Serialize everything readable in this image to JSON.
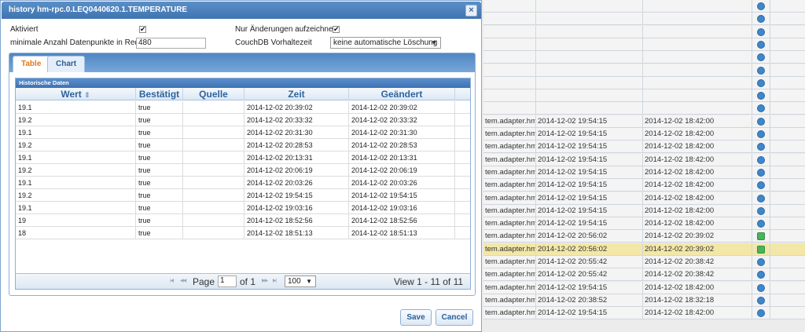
{
  "dialog": {
    "title": "history hm-rpc.0.LEQ0440620.1.TEMPERATURE",
    "close_icon": "×",
    "aktiviert_label": "Aktiviert",
    "aktiviert_checked": true,
    "nur_aenderungen_label": "Nur Änderungen aufzeichnen",
    "nur_aenderungen_checked": true,
    "min_datenpunkte_label": "minimale Anzahl Datenpunkte in Redis",
    "min_datenpunkte_value": "480",
    "couchdb_label": "CouchDB Vorhaltezeit",
    "couchdb_value": "keine automatische Löschung",
    "check_mark": "✔",
    "dropdown_arrow": "▼",
    "tabs": [
      {
        "label": "Table",
        "active": true
      },
      {
        "label": "Chart",
        "active": false
      }
    ],
    "grid": {
      "caption": "Historische Daten",
      "columns": [
        "Wert",
        "Bestätigt",
        "Quelle",
        "Zeit",
        "Geändert"
      ],
      "sort_icon": "⇕",
      "rows": [
        [
          "19.1",
          "true",
          "",
          "2014-12-02 20:39:02",
          "2014-12-02 20:39:02"
        ],
        [
          "19.2",
          "true",
          "",
          "2014-12-02 20:33:32",
          "2014-12-02 20:33:32"
        ],
        [
          "19.1",
          "true",
          "",
          "2014-12-02 20:31:30",
          "2014-12-02 20:31:30"
        ],
        [
          "19.2",
          "true",
          "",
          "2014-12-02 20:28:53",
          "2014-12-02 20:28:53"
        ],
        [
          "19.1",
          "true",
          "",
          "2014-12-02 20:13:31",
          "2014-12-02 20:13:31"
        ],
        [
          "19.2",
          "true",
          "",
          "2014-12-02 20:06:19",
          "2014-12-02 20:06:19"
        ],
        [
          "19.1",
          "true",
          "",
          "2014-12-02 20:03:26",
          "2014-12-02 20:03:26"
        ],
        [
          "19.2",
          "true",
          "",
          "2014-12-02 19:54:15",
          "2014-12-02 19:54:15"
        ],
        [
          "19.1",
          "true",
          "",
          "2014-12-02 19:03:16",
          "2014-12-02 19:03:16"
        ],
        [
          "19",
          "true",
          "",
          "2014-12-02 18:52:56",
          "2014-12-02 18:52:56"
        ],
        [
          "18",
          "true",
          "",
          "2014-12-02 18:51:13",
          "2014-12-02 18:51:13"
        ]
      ],
      "pager": {
        "first_icon": "|◀",
        "prev_icon": "◀◀",
        "next_icon": "▶▶",
        "last_icon": "▶|",
        "page_label": "Page",
        "page_value": "1",
        "of_label": "of 1",
        "rows_per_page": "100",
        "view_text": "View 1 - 11 of 11"
      }
    },
    "save_label": "Save",
    "cancel_label": "Cancel"
  },
  "background_rows": [
    {
      "c1": "",
      "c2": "",
      "c3": "",
      "icon": "blue"
    },
    {
      "c1": "",
      "c2": "",
      "c3": "",
      "icon": "blue"
    },
    {
      "c1": "",
      "c2": "",
      "c3": "",
      "icon": "blue"
    },
    {
      "c1": "",
      "c2": "",
      "c3": "",
      "icon": "blue"
    },
    {
      "c1": "",
      "c2": "",
      "c3": "",
      "icon": "blue"
    },
    {
      "c1": "",
      "c2": "",
      "c3": "",
      "icon": "blue"
    },
    {
      "c1": "",
      "c2": "",
      "c3": "",
      "icon": "blue"
    },
    {
      "c1": "",
      "c2": "",
      "c3": "",
      "icon": "blue"
    },
    {
      "c1": "",
      "c2": "",
      "c3": "",
      "icon": "blue"
    },
    {
      "c1": "tem.adapter.hm-",
      "c2": "2014-12-02 19:54:15",
      "c3": "2014-12-02 18:42:00",
      "icon": "blue"
    },
    {
      "c1": "tem.adapter.hm-",
      "c2": "2014-12-02 19:54:15",
      "c3": "2014-12-02 18:42:00",
      "icon": "blue"
    },
    {
      "c1": "tem.adapter.hm-",
      "c2": "2014-12-02 19:54:15",
      "c3": "2014-12-02 18:42:00",
      "icon": "blue"
    },
    {
      "c1": "tem.adapter.hm-",
      "c2": "2014-12-02 19:54:15",
      "c3": "2014-12-02 18:42:00",
      "icon": "blue"
    },
    {
      "c1": "tem.adapter.hm-",
      "c2": "2014-12-02 19:54:15",
      "c3": "2014-12-02 18:42:00",
      "icon": "blue"
    },
    {
      "c1": "tem.adapter.hm-",
      "c2": "2014-12-02 19:54:15",
      "c3": "2014-12-02 18:42:00",
      "icon": "blue"
    },
    {
      "c1": "tem.adapter.hm-",
      "c2": "2014-12-02 19:54:15",
      "c3": "2014-12-02 18:42:00",
      "icon": "blue"
    },
    {
      "c1": "tem.adapter.hm-",
      "c2": "2014-12-02 19:54:15",
      "c3": "2014-12-02 18:42:00",
      "icon": "blue"
    },
    {
      "c1": "tem.adapter.hm-",
      "c2": "2014-12-02 19:54:15",
      "c3": "2014-12-02 18:42:00",
      "icon": "blue"
    },
    {
      "c1": "tem.adapter.hm-",
      "c2": "2014-12-02 20:56:02",
      "c3": "2014-12-02 20:39:02",
      "icon": "green"
    },
    {
      "c1": "tem.adapter.hm-",
      "c2": "2014-12-02 20:56:02",
      "c3": "2014-12-02 20:39:02",
      "icon": "green",
      "highlight": true
    },
    {
      "c1": "tem.adapter.hm-",
      "c2": "2014-12-02 20:55:42",
      "c3": "2014-12-02 20:38:42",
      "icon": "blue"
    },
    {
      "c1": "tem.adapter.hm-",
      "c2": "2014-12-02 20:55:42",
      "c3": "2014-12-02 20:38:42",
      "icon": "blue"
    },
    {
      "c1": "tem.adapter.hm-",
      "c2": "2014-12-02 19:54:15",
      "c3": "2014-12-02 18:42:00",
      "icon": "blue"
    },
    {
      "c1": "tem.adapter.hm-",
      "c2": "2014-12-02 20:38:52",
      "c3": "2014-12-02 18:32:18",
      "icon": "blue"
    },
    {
      "c1": "tem.adapter.hm-",
      "c2": "2014-12-02 19:54:15",
      "c3": "2014-12-02 18:42:00",
      "icon": "blue"
    }
  ]
}
